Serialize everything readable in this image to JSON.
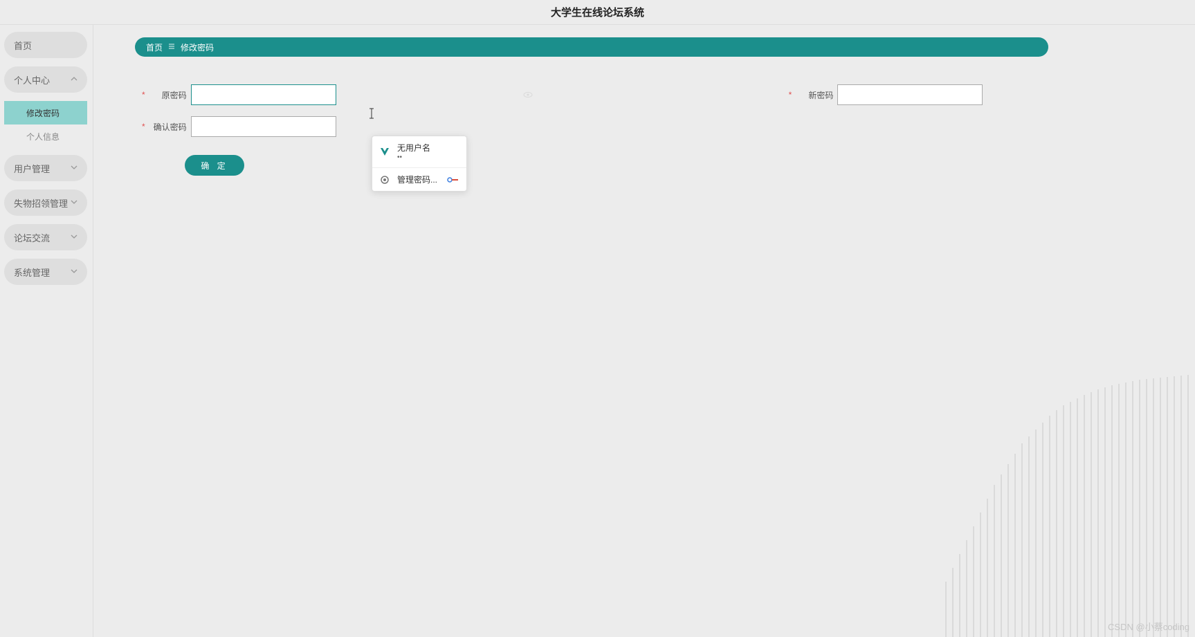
{
  "header": {
    "title": "大学生在线论坛系统"
  },
  "sidebar": {
    "items": [
      {
        "label": "首页",
        "type": "plain"
      },
      {
        "label": "个人中心",
        "type": "expand",
        "expanded": true,
        "children": [
          {
            "label": "修改密码",
            "active": true
          },
          {
            "label": "个人信息",
            "active": false
          }
        ]
      },
      {
        "label": "用户管理",
        "type": "collapse"
      },
      {
        "label": "失物招领管理",
        "type": "collapse"
      },
      {
        "label": "论坛交流",
        "type": "collapse"
      },
      {
        "label": "系统管理",
        "type": "collapse"
      }
    ]
  },
  "breadcrumb": {
    "home": "首页",
    "current": "修改密码"
  },
  "form": {
    "old_pwd_label": "原密码",
    "new_pwd_label": "新密码",
    "confirm_pwd_label": "确认密码",
    "old_pwd_value": "",
    "new_pwd_value": "",
    "confirm_pwd_value": "",
    "submit_label": "确 定"
  },
  "autofill": {
    "no_username": "无用户名",
    "pwd_mask": "••",
    "manage_label": "管理密码..."
  },
  "watermark": "CSDN @小蔡coding"
}
